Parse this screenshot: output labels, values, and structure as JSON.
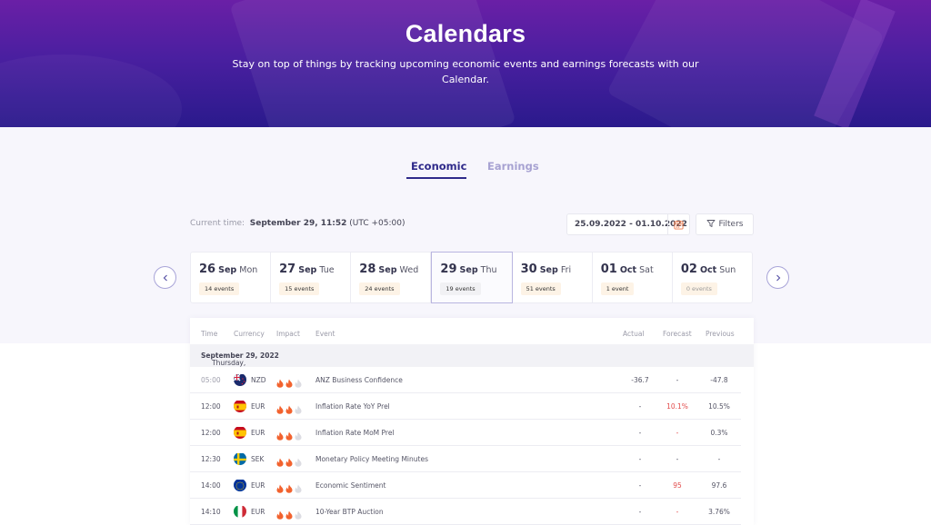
{
  "hero": {
    "title": "Calendars",
    "subtitle": "Stay on top of things by tracking upcoming economic events and earnings forecasts with our Calendar."
  },
  "tabs": [
    {
      "label": "Economic",
      "active": true
    },
    {
      "label": "Earnings",
      "active": false
    }
  ],
  "toolbar": {
    "current_time_label": "Current time:",
    "current_time_value": "September 29, 11:52",
    "timezone": "(UTC +05:00)",
    "date_range": "25.09.2022 - 01.10.2022",
    "calendar_icon": "calendar-icon",
    "filters_label": "Filters",
    "filters_icon": "funnel-icon"
  },
  "day_nav": {
    "prev_icon": "chevron-left-icon",
    "next_icon": "chevron-right-icon"
  },
  "days": [
    {
      "num": "26",
      "month": "Sep",
      "weekday": "Mon",
      "events": "14 events",
      "selected": false
    },
    {
      "num": "27",
      "month": "Sep",
      "weekday": "Tue",
      "events": "15 events",
      "selected": false
    },
    {
      "num": "28",
      "month": "Sep",
      "weekday": "Wed",
      "events": "24 events",
      "selected": false
    },
    {
      "num": "29",
      "month": "Sep",
      "weekday": "Thu",
      "events": "19 events",
      "selected": true
    },
    {
      "num": "30",
      "month": "Sep",
      "weekday": "Fri",
      "events": "51 events",
      "selected": false
    },
    {
      "num": "01",
      "month": "Oct",
      "weekday": "Sat",
      "events": "1 event",
      "selected": false
    },
    {
      "num": "02",
      "month": "Oct",
      "weekday": "Sun",
      "events": "0 events",
      "selected": false
    }
  ],
  "table": {
    "headers": {
      "time": "Time",
      "currency": "Currency",
      "impact": "Impact",
      "event": "Event",
      "actual": "Actual",
      "forecast": "Forecast",
      "previous": "Previous"
    },
    "group_weekday": "Thursday,",
    "group_date": "September 29, 2022",
    "rows": [
      {
        "time": "05:00",
        "past": true,
        "flag": "nz",
        "currency": "NZD",
        "impact": 2,
        "event": "ANZ Business Confidence",
        "actual": "-36.7",
        "forecast": "-",
        "forecast_red": false,
        "previous": "-47.8"
      },
      {
        "time": "12:00",
        "past": false,
        "flag": "es",
        "currency": "EUR",
        "impact": 2,
        "event": "Inflation Rate YoY Prel",
        "actual": "-",
        "forecast": "10.1%",
        "forecast_red": true,
        "previous": "10.5%"
      },
      {
        "time": "12:00",
        "past": false,
        "flag": "es",
        "currency": "EUR",
        "impact": 2,
        "event": "Inflation Rate MoM Prel",
        "actual": "-",
        "forecast": "-",
        "forecast_red": true,
        "previous": "0.3%"
      },
      {
        "time": "12:30",
        "past": false,
        "flag": "se",
        "currency": "SEK",
        "impact": 2,
        "event": "Monetary Policy Meeting Minutes",
        "actual": "-",
        "forecast": "-",
        "forecast_red": false,
        "previous": "-"
      },
      {
        "time": "14:00",
        "past": false,
        "flag": "eu",
        "currency": "EUR",
        "impact": 2,
        "event": "Economic Sentiment",
        "actual": "-",
        "forecast": "95",
        "forecast_red": true,
        "previous": "97.6"
      },
      {
        "time": "14:10",
        "past": false,
        "flag": "it",
        "currency": "EUR",
        "impact": 2,
        "event": "10-Year BTP Auction",
        "actual": "-",
        "forecast": "-",
        "forecast_red": true,
        "previous": "3.76%"
      }
    ]
  },
  "colors": {
    "accent": "#2f2a8a",
    "hero_top": "#6a1fa6",
    "hero_bottom": "#2a1a8c",
    "fire_active": "#f2622e",
    "fire_inactive": "#dcdce2",
    "forecast_red": "#e24b4b",
    "event_badge": "#fdf3e6"
  }
}
